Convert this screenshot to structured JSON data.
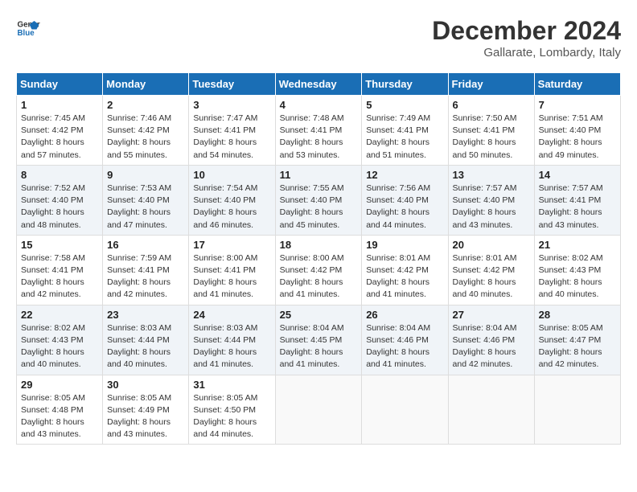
{
  "header": {
    "logo_line1": "General",
    "logo_line2": "Blue",
    "month_title": "December 2024",
    "location": "Gallarate, Lombardy, Italy"
  },
  "weekdays": [
    "Sunday",
    "Monday",
    "Tuesday",
    "Wednesday",
    "Thursday",
    "Friday",
    "Saturday"
  ],
  "weeks": [
    [
      {
        "day": "1",
        "sunrise": "7:45 AM",
        "sunset": "4:42 PM",
        "daylight": "8 hours and 57 minutes."
      },
      {
        "day": "2",
        "sunrise": "7:46 AM",
        "sunset": "4:42 PM",
        "daylight": "8 hours and 55 minutes."
      },
      {
        "day": "3",
        "sunrise": "7:47 AM",
        "sunset": "4:41 PM",
        "daylight": "8 hours and 54 minutes."
      },
      {
        "day": "4",
        "sunrise": "7:48 AM",
        "sunset": "4:41 PM",
        "daylight": "8 hours and 53 minutes."
      },
      {
        "day": "5",
        "sunrise": "7:49 AM",
        "sunset": "4:41 PM",
        "daylight": "8 hours and 51 minutes."
      },
      {
        "day": "6",
        "sunrise": "7:50 AM",
        "sunset": "4:41 PM",
        "daylight": "8 hours and 50 minutes."
      },
      {
        "day": "7",
        "sunrise": "7:51 AM",
        "sunset": "4:40 PM",
        "daylight": "8 hours and 49 minutes."
      }
    ],
    [
      {
        "day": "8",
        "sunrise": "7:52 AM",
        "sunset": "4:40 PM",
        "daylight": "8 hours and 48 minutes."
      },
      {
        "day": "9",
        "sunrise": "7:53 AM",
        "sunset": "4:40 PM",
        "daylight": "8 hours and 47 minutes."
      },
      {
        "day": "10",
        "sunrise": "7:54 AM",
        "sunset": "4:40 PM",
        "daylight": "8 hours and 46 minutes."
      },
      {
        "day": "11",
        "sunrise": "7:55 AM",
        "sunset": "4:40 PM",
        "daylight": "8 hours and 45 minutes."
      },
      {
        "day": "12",
        "sunrise": "7:56 AM",
        "sunset": "4:40 PM",
        "daylight": "8 hours and 44 minutes."
      },
      {
        "day": "13",
        "sunrise": "7:57 AM",
        "sunset": "4:40 PM",
        "daylight": "8 hours and 43 minutes."
      },
      {
        "day": "14",
        "sunrise": "7:57 AM",
        "sunset": "4:41 PM",
        "daylight": "8 hours and 43 minutes."
      }
    ],
    [
      {
        "day": "15",
        "sunrise": "7:58 AM",
        "sunset": "4:41 PM",
        "daylight": "8 hours and 42 minutes."
      },
      {
        "day": "16",
        "sunrise": "7:59 AM",
        "sunset": "4:41 PM",
        "daylight": "8 hours and 42 minutes."
      },
      {
        "day": "17",
        "sunrise": "8:00 AM",
        "sunset": "4:41 PM",
        "daylight": "8 hours and 41 minutes."
      },
      {
        "day": "18",
        "sunrise": "8:00 AM",
        "sunset": "4:42 PM",
        "daylight": "8 hours and 41 minutes."
      },
      {
        "day": "19",
        "sunrise": "8:01 AM",
        "sunset": "4:42 PM",
        "daylight": "8 hours and 41 minutes."
      },
      {
        "day": "20",
        "sunrise": "8:01 AM",
        "sunset": "4:42 PM",
        "daylight": "8 hours and 40 minutes."
      },
      {
        "day": "21",
        "sunrise": "8:02 AM",
        "sunset": "4:43 PM",
        "daylight": "8 hours and 40 minutes."
      }
    ],
    [
      {
        "day": "22",
        "sunrise": "8:02 AM",
        "sunset": "4:43 PM",
        "daylight": "8 hours and 40 minutes."
      },
      {
        "day": "23",
        "sunrise": "8:03 AM",
        "sunset": "4:44 PM",
        "daylight": "8 hours and 40 minutes."
      },
      {
        "day": "24",
        "sunrise": "8:03 AM",
        "sunset": "4:44 PM",
        "daylight": "8 hours and 41 minutes."
      },
      {
        "day": "25",
        "sunrise": "8:04 AM",
        "sunset": "4:45 PM",
        "daylight": "8 hours and 41 minutes."
      },
      {
        "day": "26",
        "sunrise": "8:04 AM",
        "sunset": "4:46 PM",
        "daylight": "8 hours and 41 minutes."
      },
      {
        "day": "27",
        "sunrise": "8:04 AM",
        "sunset": "4:46 PM",
        "daylight": "8 hours and 42 minutes."
      },
      {
        "day": "28",
        "sunrise": "8:05 AM",
        "sunset": "4:47 PM",
        "daylight": "8 hours and 42 minutes."
      }
    ],
    [
      {
        "day": "29",
        "sunrise": "8:05 AM",
        "sunset": "4:48 PM",
        "daylight": "8 hours and 43 minutes."
      },
      {
        "day": "30",
        "sunrise": "8:05 AM",
        "sunset": "4:49 PM",
        "daylight": "8 hours and 43 minutes."
      },
      {
        "day": "31",
        "sunrise": "8:05 AM",
        "sunset": "4:50 PM",
        "daylight": "8 hours and 44 minutes."
      },
      null,
      null,
      null,
      null
    ]
  ],
  "labels": {
    "sunrise": "Sunrise: ",
    "sunset": "Sunset: ",
    "daylight": "Daylight: "
  }
}
